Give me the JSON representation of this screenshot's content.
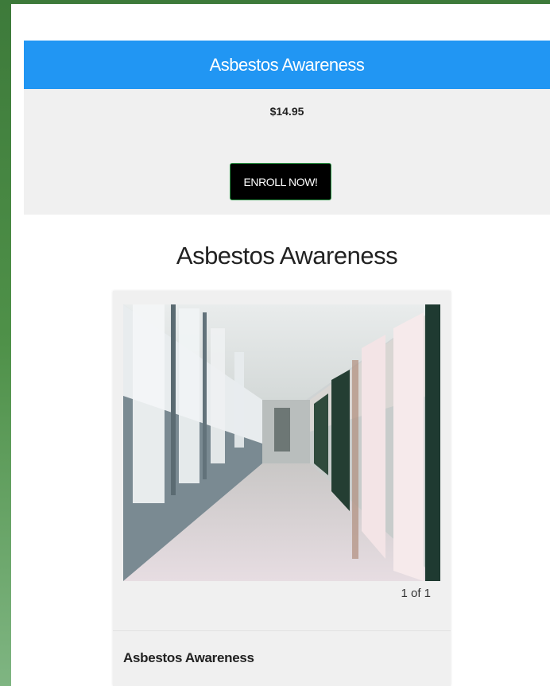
{
  "course_card": {
    "title": "Asbestos Awareness",
    "price": "$14.95",
    "enroll_label": "ENROLL NOW!",
    "header_color": "#2196f3"
  },
  "page_title": "Asbestos Awareness",
  "gallery": {
    "image_description_icon": "hallway-photo",
    "counter": "1 of 1",
    "caption": "Asbestos Awareness"
  }
}
